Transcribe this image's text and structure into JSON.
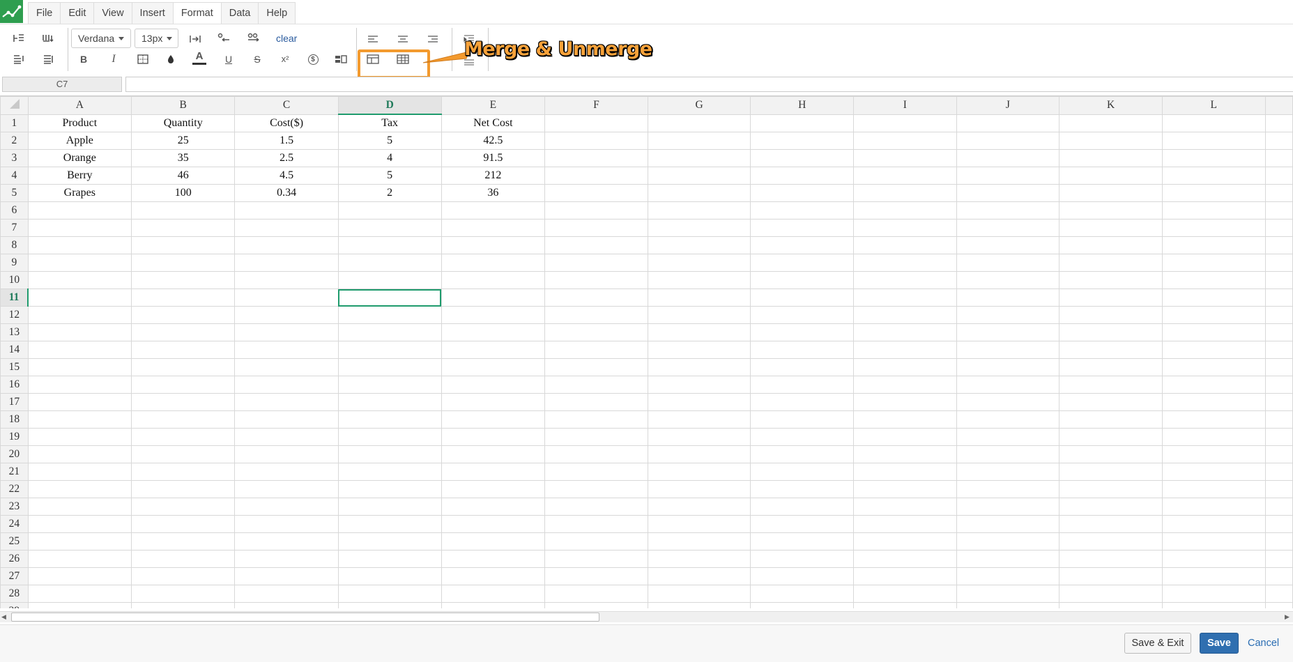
{
  "menu": {
    "items": [
      {
        "label": "File"
      },
      {
        "label": "Edit"
      },
      {
        "label": "View"
      },
      {
        "label": "Insert"
      },
      {
        "label": "Format",
        "active": true
      },
      {
        "label": "Data"
      },
      {
        "label": "Help"
      }
    ]
  },
  "toolbar": {
    "font_family": "Verdana",
    "font_size": "13px",
    "clear_label": "clear",
    "bold_glyph": "B",
    "italic_glyph": "I",
    "underline_glyph": "U",
    "strike_glyph": "S",
    "text_color_glyph": "A",
    "superscript_glyph": "x²",
    "currency_glyph": "$",
    "icons": [
      "insert-row-icon",
      "insert-column-icon",
      "delete-row-icon",
      "delete-column-icon",
      "wrap-text-icon",
      "decrease-decimal-icon",
      "increase-decimal-icon",
      "borders-icon",
      "fill-color-icon",
      "conditional-format-icon",
      "align-left-icon",
      "align-center-icon",
      "align-right-icon",
      "indent-icon",
      "merge-cells-icon",
      "unmerge-cells-icon",
      "outdent-icon"
    ]
  },
  "annotation": {
    "text": "Merge & Unmerge",
    "color": "#f39a2e"
  },
  "formula_bar": {
    "cell_ref": "C7",
    "value": ""
  },
  "sheet": {
    "columns": [
      "A",
      "B",
      "C",
      "D",
      "E",
      "F",
      "G",
      "H",
      "I",
      "J",
      "K",
      "L"
    ],
    "selected_column": "D",
    "selected_row": 11,
    "row_count": 28,
    "rows": [
      [
        "Product",
        "Quantity",
        "Cost($)",
        "Tax",
        "Net Cost"
      ],
      [
        "Apple",
        "25",
        "1.5",
        "5",
        "42.5"
      ],
      [
        "Orange",
        "35",
        "2.5",
        "4",
        "91.5"
      ],
      [
        "Berry",
        "46",
        "4.5",
        "5",
        "212"
      ],
      [
        "Grapes",
        "100",
        "0.34",
        "2",
        "36"
      ]
    ]
  },
  "footer": {
    "save_exit_label": "Save & Exit",
    "save_label": "Save",
    "cancel_label": "Cancel"
  },
  "colors": {
    "accent": "#1f9b6d",
    "save_button": "#2f6fb0",
    "logo": "#2e9e4f"
  }
}
